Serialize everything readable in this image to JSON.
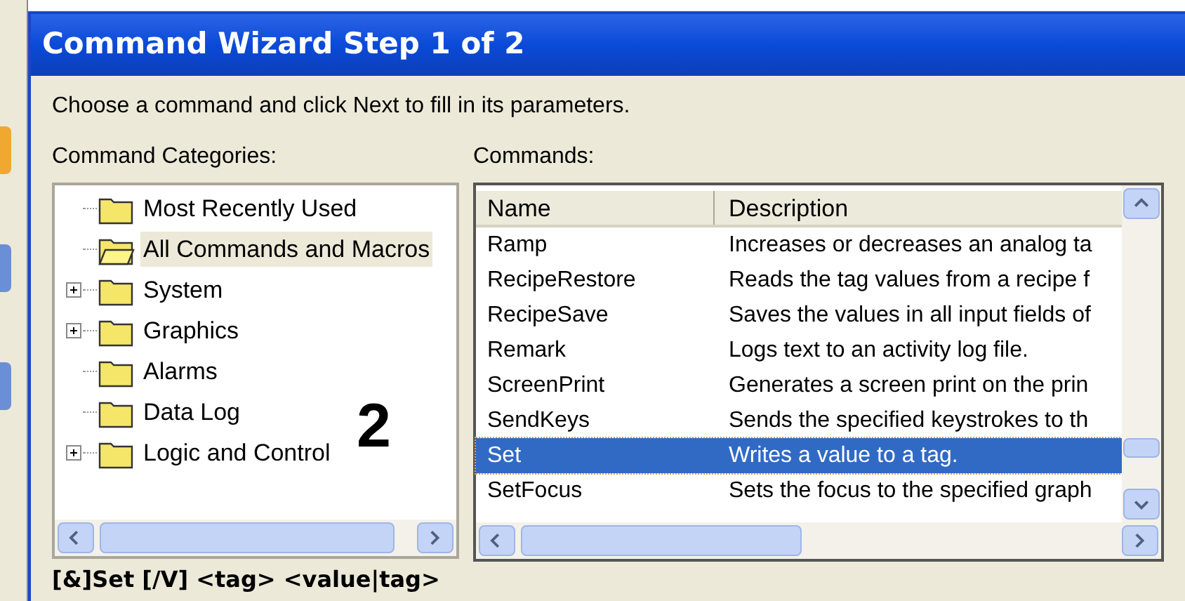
{
  "window": {
    "title": "Command Wizard Step 1 of 2"
  },
  "instruction": "Choose a command and click Next to fill in its parameters.",
  "categories": {
    "label": "Command Categories:",
    "items": [
      {
        "label": "Most Recently Used",
        "expandable": false,
        "selected": false
      },
      {
        "label": "All Commands and Macros",
        "expandable": false,
        "selected": true
      },
      {
        "label": "System",
        "expandable": true,
        "selected": false
      },
      {
        "label": "Graphics",
        "expandable": true,
        "selected": false
      },
      {
        "label": "Alarms",
        "expandable": false,
        "selected": false
      },
      {
        "label": "Data Log",
        "expandable": false,
        "selected": false
      },
      {
        "label": "Logic and Control",
        "expandable": true,
        "selected": false
      }
    ]
  },
  "commands": {
    "label": "Commands:",
    "columns": [
      "Name",
      "Description"
    ],
    "rows": [
      {
        "name": "Ramp",
        "description": "Increases or decreases an analog ta",
        "selected": false
      },
      {
        "name": "RecipeRestore",
        "description": "Reads the tag values from a recipe f",
        "selected": false
      },
      {
        "name": "RecipeSave",
        "description": "Saves the values in all input fields of",
        "selected": false
      },
      {
        "name": "Remark",
        "description": "Logs text to an activity log file.",
        "selected": false
      },
      {
        "name": "ScreenPrint",
        "description": "Generates a screen print on the prin",
        "selected": false
      },
      {
        "name": "SendKeys",
        "description": "Sends the specified keystrokes to th",
        "selected": false
      },
      {
        "name": "Set",
        "description": "Writes a value to a tag.",
        "selected": true
      },
      {
        "name": "SetFocus",
        "description": "Sets the focus to the specified graph",
        "selected": false
      }
    ]
  },
  "syntax": "[&]Set [/V] <tag> <value|tag>",
  "annotation": "2"
}
